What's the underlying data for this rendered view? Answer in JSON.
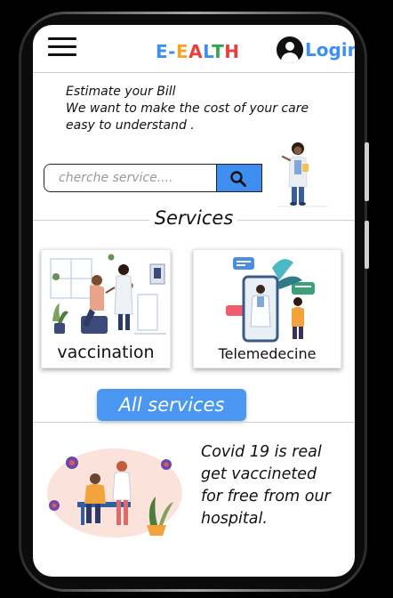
{
  "header": {
    "brand_letters": [
      {
        "char": "E",
        "color": "#3f8ff2"
      },
      {
        "char": "-",
        "color": "#3f8ff2"
      },
      {
        "char": "E",
        "color": "#f2a62b"
      },
      {
        "char": "A",
        "color": "#e8413a"
      },
      {
        "char": "L",
        "color": "#3f8ff2"
      },
      {
        "char": "T",
        "color": "#2fa84f"
      },
      {
        "char": "H",
        "color": "#e8413a"
      }
    ],
    "login_label": "Login",
    "menu_icon": "hamburger-icon",
    "user_icon": "user-icon"
  },
  "intro": {
    "line1": "Estimate your Bill",
    "line2": "We want to make the cost of your care",
    "line3": "easy to understand ."
  },
  "search": {
    "placeholder": "cherche service....",
    "value": "",
    "button_icon": "search-icon"
  },
  "services": {
    "title": "Services",
    "cards": [
      {
        "label": "vaccination"
      },
      {
        "label": "Telemedecine"
      }
    ],
    "all_label": "All services"
  },
  "covid": {
    "line1": "Covid 19 is real",
    "line2": "get vaccineted",
    "line3": "for free from our",
    "line4": "hospital."
  },
  "colors": {
    "accent": "#3f8ff2",
    "button": "#4a97f2"
  }
}
